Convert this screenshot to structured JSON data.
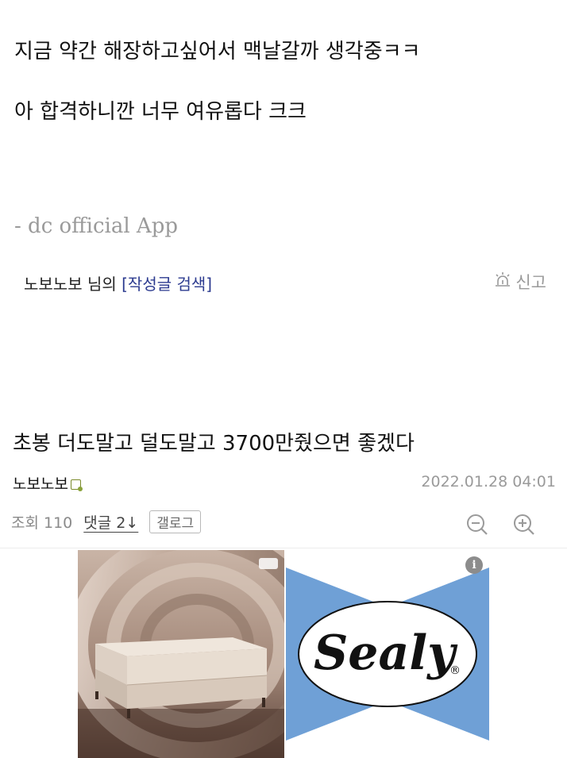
{
  "post_body": {
    "line1": "지금 약간 해장하고싶어서 맥날갈까 생각중ㅋㅋ",
    "line2": "아 합격하니깐 너무 여유롭다 크크",
    "signature": "- dc official App"
  },
  "author_bar": {
    "author_label": "노보노보 님의 ",
    "search_link": "[작성글 검색]",
    "report_label": "신고"
  },
  "next_post": {
    "title": "초봉 더도말고 덜도말고 3700만줬으면 좋겠다",
    "nickname": "노보노보",
    "date": "2022.01.28 04:01",
    "views_label": "조회 110",
    "comments_label": "댓글 2↓",
    "gallog_button": "갤로그"
  },
  "ad": {
    "brand": "Sealy",
    "registered": "®",
    "info_icon": "i",
    "colors": {
      "logo_blue": "#6fa0d6",
      "logo_black": "#111111"
    }
  }
}
